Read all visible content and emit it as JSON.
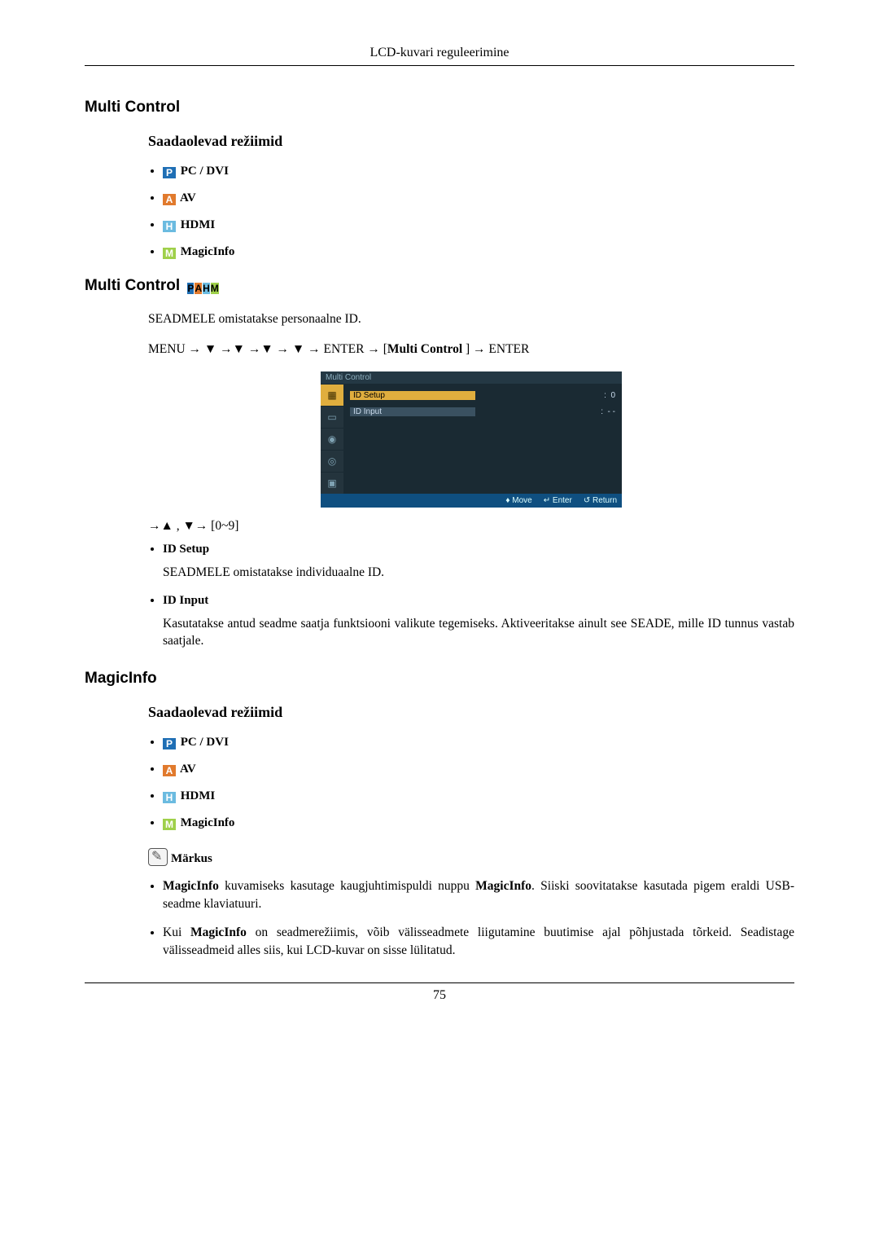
{
  "header": {
    "title": "LCD-kuvari reguleerimine"
  },
  "page_number": "75",
  "section1": {
    "title": "Multi Control",
    "sub": "Saadaolevad režiimid",
    "modes": {
      "pc": "PC / DVI",
      "av": "AV",
      "hdmi": "HDMI",
      "magic": "MagicInfo"
    }
  },
  "section2": {
    "title": "Multi Control",
    "intro": "SEADMELE omistatakse personaalne ID.",
    "menu_path_prefix": "MENU → ▼ →▼ →▼ → ▼ → ENTER → [",
    "menu_path_bold": "Multi Control",
    "menu_path_suffix": " ] → ENTER",
    "osd": {
      "title": "Multi Control",
      "rows": {
        "r1_label": "ID  Setup",
        "r1_val": "0",
        "r2_label": "ID  Input",
        "r2_val": "- -"
      },
      "footer": {
        "move": "Move",
        "enter": "Enter",
        "return": "Return"
      }
    },
    "arrow_line": "→▲ , ▼→ [0~9]",
    "items": {
      "id_setup_t": "ID Setup",
      "id_setup_b": "SEADMELE omistatakse individuaalne ID.",
      "id_input_t": "ID Input",
      "id_input_b": "Kasutatakse antud seadme saatja funktsiooni valikute tegemiseks. Aktiveeritakse ainult see SEADE, mille ID tunnus vastab saatjale."
    }
  },
  "section3": {
    "title": "MagicInfo",
    "sub": "Saadaolevad režiimid",
    "modes": {
      "pc": "PC / DVI",
      "av": "AV",
      "hdmi": "HDMI",
      "magic": "MagicInfo"
    },
    "note_label": "Märkus",
    "notes": {
      "n1_a": "MagicInfo",
      "n1_b": " kuvamiseks kasutage kaugjuhtimispuldi nuppu ",
      "n1_c": "MagicInfo",
      "n1_d": ". Siiski soovitatakse kasutada pigem eraldi USB-seadme klaviatuuri.",
      "n2_a": "Kui ",
      "n2_b": "MagicInfo",
      "n2_c": " on seadmerežiimis, võib välisseadmete liigutamine buutimise ajal põhjustada tõrkeid. Seadistage välisseadmeid alles siis, kui LCD-kuvar on sisse lülitatud."
    }
  }
}
